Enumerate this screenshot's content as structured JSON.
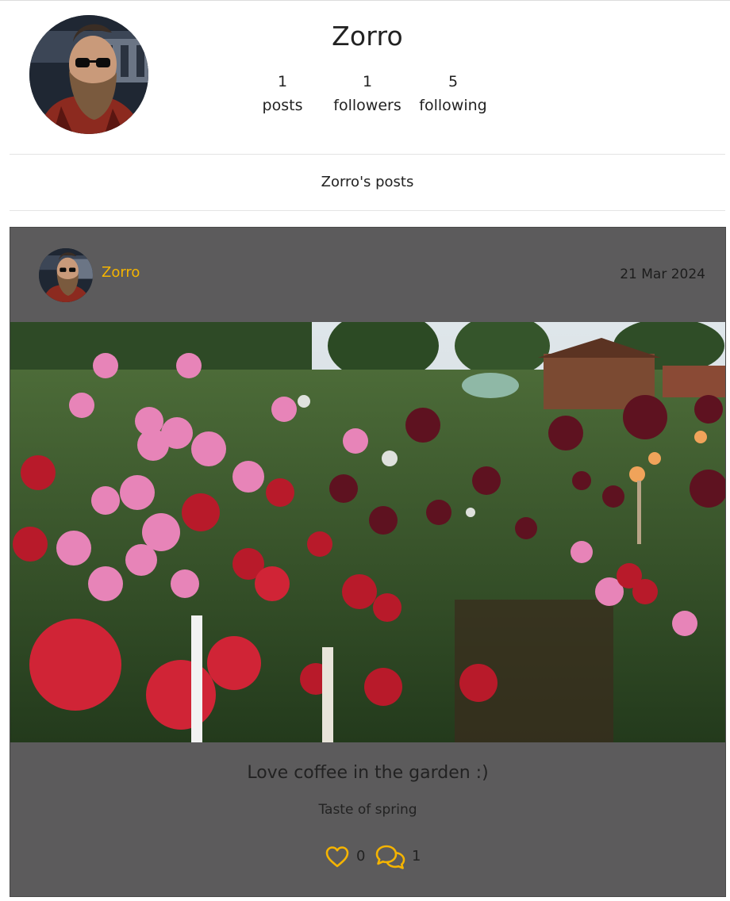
{
  "profile": {
    "username": "Zorro",
    "stats": [
      {
        "value": "1",
        "label": "posts"
      },
      {
        "value": "1",
        "label": "followers"
      },
      {
        "value": "5",
        "label": "following"
      }
    ]
  },
  "section_title": "Zorro's posts",
  "post": {
    "author": "Zorro",
    "date": "21 Mar 2024",
    "title": "Love coffee in the garden :)",
    "body": "Taste of spring",
    "likes": "0",
    "comments": "1"
  },
  "colors": {
    "accent": "#f5b400",
    "card_background": "#5c5b5c"
  },
  "icons": {
    "like": "heart-icon",
    "comment": "comments-icon"
  }
}
